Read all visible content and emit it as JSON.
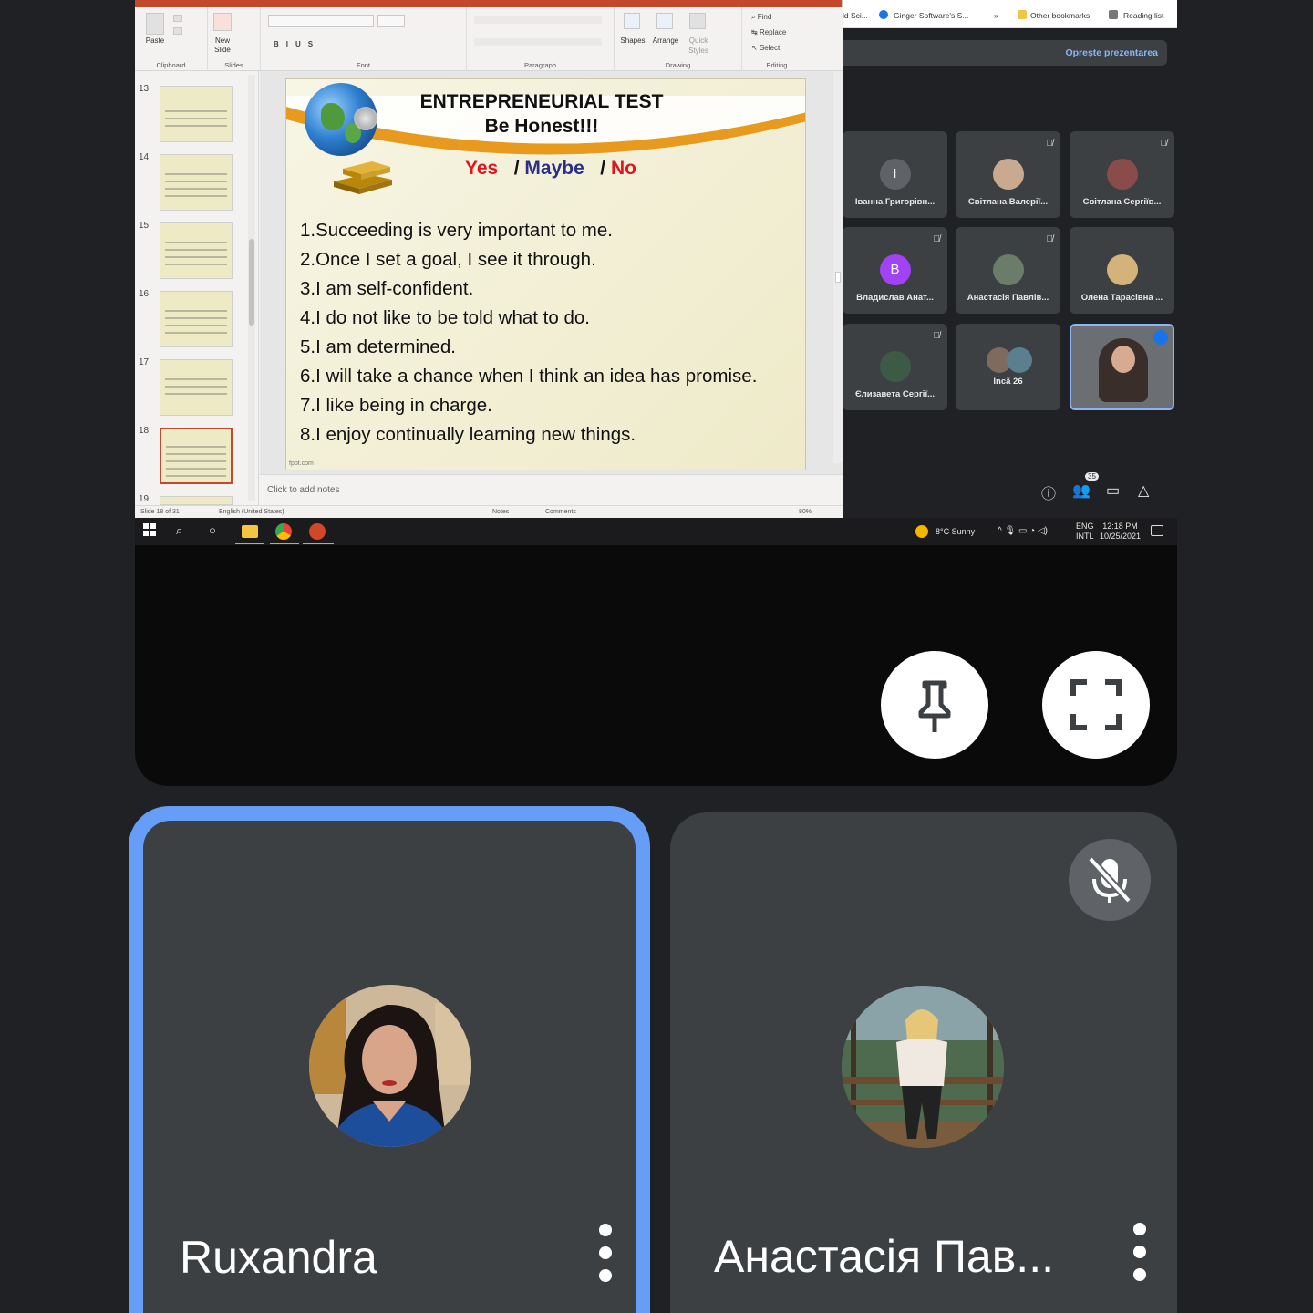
{
  "ppt": {
    "ribbon": {
      "clipboard": {
        "label": "Clipboard",
        "paste": "Paste"
      },
      "slides": {
        "label": "Slides",
        "new_slide_line1": "New",
        "new_slide_line2": "Slide"
      },
      "font": {
        "label": "Font"
      },
      "paragraph": {
        "label": "Paragraph"
      },
      "drawing": {
        "label": "Drawing",
        "shapes": "Shapes",
        "arrange": "Arrange",
        "quick_styles_line1": "Quick",
        "quick_styles_line2": "Styles"
      },
      "editing": {
        "label": "Editing",
        "find": "Find",
        "replace": "Replace",
        "select": "Select"
      }
    },
    "thumb_numbers": [
      "13",
      "14",
      "15",
      "16",
      "17",
      "18",
      "19"
    ],
    "slide": {
      "title_line1": "ENTREPRENEURIAL TEST",
      "title_line2": "Be Honest!!!",
      "yes": "Yes",
      "maybe": "Maybe",
      "no": "No",
      "items": [
        "1.Succeeding is very important to me.",
        "2.Once I set a goal, I see it through.",
        "3.I am self-confident.",
        "4.I do not like to be told what to do.",
        "5.I am determined.",
        "6.I will take a chance when I think an idea has promise.",
        "7.I like being in charge.",
        "8.I enjoy continually learning new things."
      ],
      "credit": "fppt.com"
    },
    "notes_placeholder": "Click to add notes",
    "status": {
      "slide_of": "Slide 18 of 31",
      "language": "English (United States)",
      "notes": "Notes",
      "comments": "Comments",
      "zoom": "80%"
    }
  },
  "browser": {
    "bookmarks": [
      "ld Sci...",
      "Ginger Software's S...",
      "»",
      "Other bookmarks",
      "Reading list"
    ]
  },
  "meet": {
    "stop_presenting": "Oprește prezentarea",
    "tiles": [
      {
        "name": "Іванна Григорівн...",
        "initial": "І",
        "color": "#5f6368",
        "muted": false
      },
      {
        "name": "Світлана Валерії...",
        "initial": "",
        "color": "#c9a98f",
        "muted": true
      },
      {
        "name": "Світлана Сергіїв...",
        "initial": "",
        "color": "#8a4b4b",
        "muted": true
      },
      {
        "name": "Владислав Анат...",
        "initial": "B",
        "color": "#a142f4",
        "muted": true
      },
      {
        "name": "Анастасія Павлів...",
        "initial": "",
        "color": "#6b7d6a",
        "muted": true
      },
      {
        "name": "Олена Тарасівна ...",
        "initial": "",
        "color": "#d4b37a",
        "muted": false
      },
      {
        "name": "Єлизавета Сергії...",
        "initial": "",
        "color": "#3d5a47",
        "muted": true
      },
      {
        "name": "Încă 26",
        "initial": "",
        "color": "#7e6a5e",
        "muted": false
      }
    ],
    "participant_count": "35"
  },
  "taskbar": {
    "weather": "8°C  Sunny",
    "lang1": "ENG",
    "lang2": "INTL",
    "time": "12:18 PM",
    "date": "10/25/2021"
  },
  "participants": [
    {
      "name": "Ruxandra",
      "speaking": true,
      "muted": false
    },
    {
      "name": "Анастасія Пав...",
      "speaking": false,
      "muted": true
    }
  ],
  "icons": {
    "pin": "pin-icon",
    "fullscreen": "fullscreen-icon",
    "mic_off": "mic-off-icon",
    "more": "more-vert-icon"
  },
  "colors": {
    "background": "#202124",
    "tile": "#3c4043",
    "speaking_border": "#669df6",
    "ppt_accent": "#c4492c",
    "link_blue": "#8ab4f8"
  }
}
